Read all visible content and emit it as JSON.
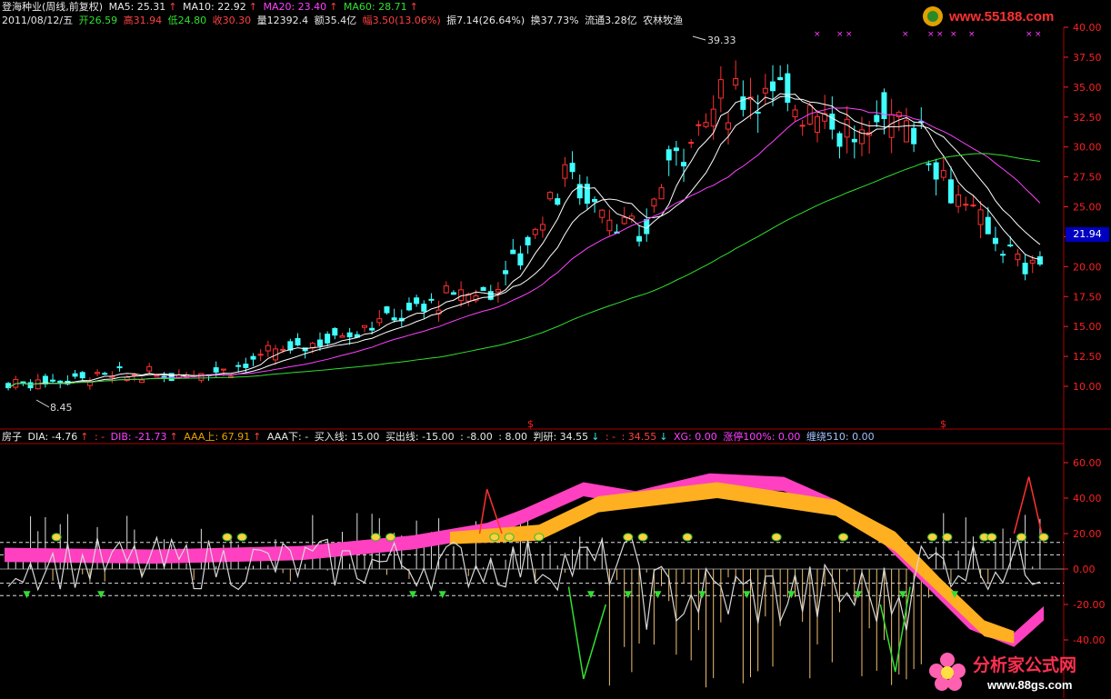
{
  "header": {
    "stock": "登海种业(周线,前复权)",
    "ma5": "MA5: 25.31",
    "ma10": "MA10: 22.92",
    "ma20": "MA20: 23.40",
    "ma60": "MA60: 28.71",
    "date": "2011/08/12/五",
    "open": "开26.59",
    "high": "高31.94",
    "low": "低24.80",
    "close": "收30.30",
    "vol": "量12392.4",
    "amount": "额35.4亿",
    "change": "幅3.50(13.06%)",
    "amp": "振7.14(26.64%)",
    "turnover": "换37.73%",
    "float": "流通3.28亿",
    "sector": "农林牧渔",
    "arrow_up": "↑"
  },
  "indicator": {
    "name": "房子",
    "dia": "DIA: -4.76",
    "sep1": ": -",
    "dib": "DIB: -21.73",
    "aaa_up": "AAA上: 67.91",
    "aaa_down": "AAA下: -",
    "buy": "买入线: 15.00",
    "sell": "买出线: -15.00",
    "v1": ": -8.00",
    "v2": ": 8.00",
    "judge": "判研: 34.55",
    "sep2": ": -",
    "v3": ": 34.55",
    "xg": "XG: 0.00",
    "zt": "涨停100%: 0.00",
    "chan": "缠绕510: 0.00",
    "arrow_up": "↑",
    "arrow_down": "↓"
  },
  "price_axis": [
    "40.00",
    "37.50",
    "35.00",
    "32.50",
    "30.00",
    "27.50",
    "25.00",
    "22.50",
    "20.00",
    "17.50",
    "15.00",
    "12.50",
    "10.00"
  ],
  "ind_axis": [
    "60.00",
    "40.00",
    "20.00",
    "0.00",
    "-20.00",
    "-40.00"
  ],
  "current_price": "21.94",
  "annotations": {
    "high": "39.33",
    "low": "8.45"
  },
  "markers": {
    "s1": "$",
    "s2": "$"
  },
  "logos": {
    "top": "www.55188.com",
    "bottom_cn": "分析家公式网",
    "bottom_url": "www.88gs.com"
  },
  "colors": {
    "up": "#ff3030",
    "down": "#40ffff",
    "ma5": "#ffffff",
    "ma10": "#ffff00",
    "ma20": "#ff40ff",
    "ma60": "#30e030"
  }
}
